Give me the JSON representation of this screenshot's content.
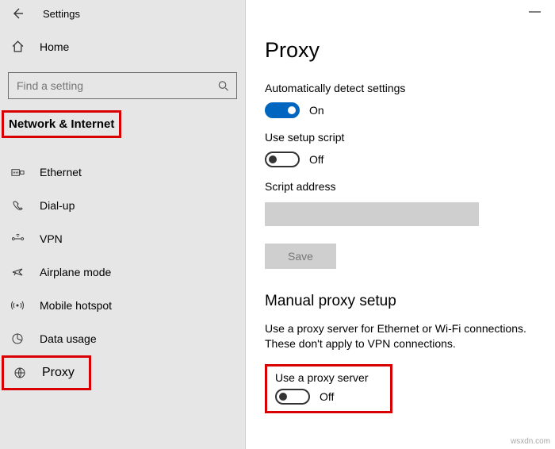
{
  "titlebar": {
    "title": "Settings"
  },
  "home": {
    "label": "Home"
  },
  "search": {
    "placeholder": "Find a setting"
  },
  "section": {
    "header": "Network & Internet"
  },
  "nav": {
    "ethernet": "Ethernet",
    "dialup": "Dial-up",
    "vpn": "VPN",
    "airplane": "Airplane mode",
    "hotspot": "Mobile hotspot",
    "datausage": "Data usage",
    "proxy": "Proxy"
  },
  "main": {
    "title": "Proxy",
    "auto_label": "Automatically detect settings",
    "auto_state": "On",
    "setup_label": "Use setup script",
    "setup_state": "Off",
    "script_label": "Script address",
    "save_btn": "Save",
    "manual_title": "Manual proxy setup",
    "manual_desc": "Use a proxy server for Ethernet or Wi-Fi connections. These don't apply to VPN connections.",
    "useproxy_label": "Use a proxy server",
    "useproxy_state": "Off"
  },
  "watermark": "wsxdn.com"
}
